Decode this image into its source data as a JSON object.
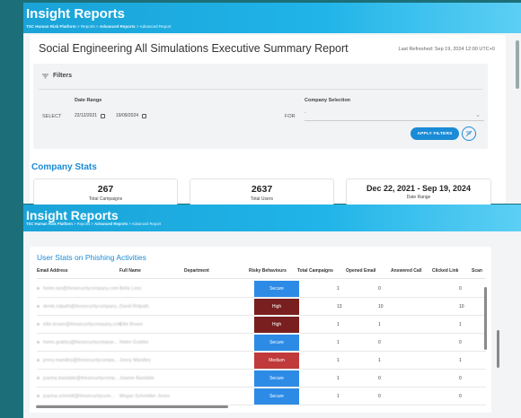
{
  "header": {
    "title": "Insight Reports",
    "breadcrumb_1": "TSC Human Risk Platform",
    "breadcrumb_2": "Reports",
    "breadcrumb_3": "Advanced Reports",
    "breadcrumb_4": "Advanced Report",
    "separator": ">"
  },
  "report": {
    "title": "Social Engineering All Simulations Executive Summary Report",
    "last_refreshed": "Last Refreshed: Sep 19, 2024 12:00 UTC+0"
  },
  "filters": {
    "heading": "Filters",
    "date_range_label": "Date Range",
    "select_label": "SELECT",
    "date_from": "22/12/2021",
    "date_to": "19/09/2024",
    "company_label": "Company Selection",
    "for_label": "FOR",
    "company_value": "-",
    "apply_label": "APPLY FILTERS"
  },
  "company_stats": {
    "heading": "Company Stats",
    "total_campaigns_value": "267",
    "total_campaigns_label": "Total Campaigns",
    "total_users_value": "2637",
    "total_users_label": "Total Users",
    "date_range_value": "Dec 22, 2021 - Sep 19, 2024",
    "date_range_label": "Date Range"
  },
  "user_stats": {
    "heading": "User Stats on Phishing Activities",
    "columns": [
      "Email Address",
      "Full Name",
      "Department",
      "Risky Behaviours",
      "Total Campaigns",
      "Opened Email",
      "Answered Call",
      "Clicked Link",
      "Scan"
    ],
    "rows": [
      {
        "email": "helen.tan@thesecuritycompany.com",
        "name": "Bella Lees",
        "risk": "Secure",
        "risk_class": "secure",
        "campaigns": "1",
        "opened": "0",
        "answered": "",
        "clicked": "0"
      },
      {
        "email": "derek.ridpath@thesecuritycompany...",
        "name": "David Ridpath",
        "risk": "High",
        "risk_class": "high",
        "campaigns": "13",
        "opened": "10",
        "answered": "",
        "clicked": "10"
      },
      {
        "email": "ellie.brown@thesecuritycompany.com",
        "name": "Ellie Brown",
        "risk": "High",
        "risk_class": "high",
        "campaigns": "1",
        "opened": "1",
        "answered": "",
        "clicked": "1"
      },
      {
        "email": "helen.grabbs@thesecuritycompan...",
        "name": "Helen Grabbe",
        "risk": "Secure",
        "risk_class": "secure",
        "campaigns": "1",
        "opened": "0",
        "answered": "",
        "clicked": "0"
      },
      {
        "email": "jenny.mandley@thesecuritycompa...",
        "name": "Jenny Mandley",
        "risk": "Medium",
        "risk_class": "medium",
        "campaigns": "1",
        "opened": "1",
        "answered": "",
        "clicked": "1"
      },
      {
        "email": "joanna.bastable@thesecuritycomp...",
        "name": "Joanne Bastable",
        "risk": "Secure",
        "risk_class": "secure",
        "campaigns": "1",
        "opened": "0",
        "answered": "",
        "clicked": "0"
      },
      {
        "email": "joanna.schmidt@thesecuritycom...",
        "name": "Megan Schmidter Jones",
        "risk": "Secure",
        "risk_class": "secure",
        "campaigns": "1",
        "opened": "0",
        "answered": "",
        "clicked": "0"
      }
    ]
  },
  "colors": {
    "accent": "#1a8bd6",
    "secure": "#2d8be6",
    "high": "#7a1f1f",
    "medium": "#c0393b",
    "background": "#1c6f78"
  },
  "icons": {
    "filter": "filter-icon",
    "calendar": "calendar-icon",
    "chevron": "chevron-down-icon",
    "reset": "reset-filter-icon"
  }
}
